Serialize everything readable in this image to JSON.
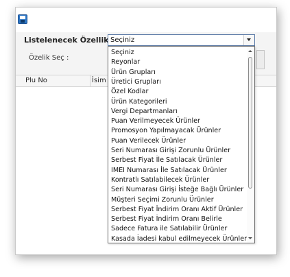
{
  "form": {
    "list_label": "Listelenecek Özellik :",
    "select_label": "Özelik Seç :",
    "combo_value": "Seçiniz"
  },
  "grid": {
    "columns": [
      "Plu No",
      "İsim"
    ]
  },
  "dropdown": {
    "options": [
      "Seçiniz",
      "Reyonlar",
      "Ürün Grupları",
      "Üretici Grupları",
      "Özel Kodlar",
      "Ürün Kategorileri",
      "Vergi Departmanları",
      "Puan Verilmeyecek Ürünler",
      "Promosyon Yapılmayacak Ürünler",
      "Puan Verilecek Ürünler",
      "Seri Numarası Girişi Zorunlu Ürünler",
      "Serbest Fiyat İle Satılacak Ürünler",
      "IMEI Numarası İle Satılacak Ürünler",
      "Kontratlı Satılabilecek Ürünler",
      "Seri Numarası Girişi İsteğe Bağlı Ürünler",
      "Müşteri Seçimi Zorunlu Ürünler",
      "Serbest Fiyat İndirim Oranı Aktif Ürünler",
      "Serbest Fiyat İndirim Oranı Belirle",
      "Sadece Fatura ile Satılabilir Ürünler",
      "Kasada İadesi kabul edilmeyecek Ürünler"
    ]
  },
  "icons": {
    "save": "save-icon",
    "combo_arrow": "chevron-down-icon",
    "scroll_up": "scroll-up-arrow-icon",
    "scroll_down": "scroll-down-arrow-icon"
  },
  "colors": {
    "save_icon": "#2f78c6",
    "combo_border": "#5b7aa6"
  }
}
